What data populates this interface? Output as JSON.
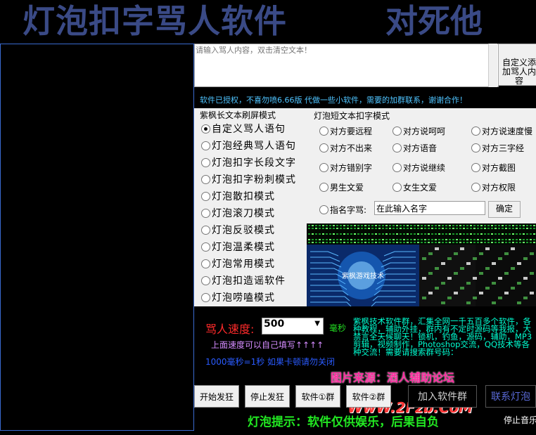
{
  "title": {
    "main": "灯泡扣字骂人软件",
    "side": "对死他"
  },
  "input": {
    "placeholder": "请输入骂人内容，双击清空文本！"
  },
  "custom_button": {
    "label": "自定义添加骂人内容"
  },
  "notice": "软件已授权，不喜勿喷6.66版  代做一些小软件，需要的加群联系，谢谢合作！",
  "long_mode": {
    "title": "紫枫长文本刷屏模式",
    "options": [
      {
        "label": "自定义骂人语句",
        "selected": true
      },
      {
        "label": "灯泡经典骂人语句",
        "selected": false
      },
      {
        "label": "灯泡扣字长段文字",
        "selected": false
      },
      {
        "label": "灯泡扣字粉刺模式",
        "selected": false
      },
      {
        "label": "灯泡散扣模式",
        "selected": false
      },
      {
        "label": "灯泡滚刀模式",
        "selected": false
      },
      {
        "label": "灯泡反驳模式",
        "selected": false
      },
      {
        "label": "灯泡温柔模式",
        "selected": false
      },
      {
        "label": "灯泡常用模式",
        "selected": false
      },
      {
        "label": "灯泡扣造谣软件",
        "selected": false
      },
      {
        "label": "灯泡唠嗑模式",
        "selected": false
      }
    ]
  },
  "short_mode": {
    "title": "灯泡短文本扣字模式",
    "options": [
      [
        "对方要远程",
        "对方说呵呵",
        "对方说速度慢"
      ],
      [
        "对方不出来",
        "对方语音",
        "对方三字经"
      ],
      [
        "对方错别字",
        "对方说继续",
        "对方截图"
      ],
      [
        "男生文爱",
        "女生文爱",
        "对方权限"
      ]
    ],
    "name_label": "指名字骂:",
    "name_value": "在此输入名字",
    "confirm": "确定"
  },
  "speed": {
    "label": "骂人速度:",
    "value": "500",
    "unit": "毫秒",
    "hint1": "上面速度可以自己填写↑↑↑↑",
    "hint2": "1000毫秒=1秒 如果卡顿请勿关闭"
  },
  "group_info": "紫枫技术软件群，汇集全网一千五百多个软件，各种教程，辅助外挂，群内有不定时源码等我报，大禁言全天候聊天！锁机，钓鱼，源码，辅助，MP3剪辑，视频制作，Photoshop交流，QQ技术等各种交流！需要请搜索群号码：",
  "matrix_caption": "紫枫游戏技术",
  "watermark": {
    "line1": "图片来源：酒人辅助论坛",
    "line2": "WwW.2Fzb.CoM"
  },
  "buttons": {
    "start": "开始发狂",
    "stop": "停止发狂",
    "group1": "软件①群",
    "group2": "软件②群",
    "join": "加入软件群",
    "contact": "联系灯泡"
  },
  "footer": {
    "tip": "灯泡提示：软件仅供娱乐，后果自负",
    "stop_music": "停止音乐"
  },
  "colors": {
    "title": "#3a4a86",
    "notice": "#4fc4ff",
    "speed_label": "#ff2a2a",
    "group_info": "#00ffd2",
    "footer": "#22e822"
  }
}
